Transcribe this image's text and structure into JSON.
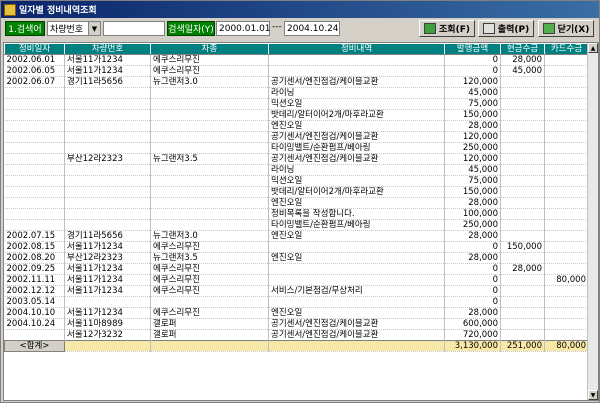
{
  "window": {
    "title": "일자별 정비내역조회"
  },
  "toolbar": {
    "search_label": "1.검색어",
    "search_field": "차량번호",
    "search_value": "",
    "date_label": "검색일자(Y)",
    "date_from": "2000.01.01",
    "date_sep": "---",
    "date_to": "2004.10.24",
    "query_button": "조회(F)",
    "print_button": "출력(P)",
    "close_button": "닫기(X)"
  },
  "grid": {
    "headers": [
      "정비일자",
      "차량번호",
      "차종",
      "정비내역",
      "발행금액",
      "현금수금",
      "카드수금"
    ],
    "rows": [
      [
        "2002.06.01",
        "서울11가1234",
        "에쿠스리무진",
        "",
        "0",
        "28,000",
        ""
      ],
      [
        "2002.06.05",
        "서울11가1234",
        "에쿠스리무진",
        "",
        "0",
        "45,000",
        ""
      ],
      [
        "2002.06.07",
        "경기11라5656",
        "뉴그랜저3.0",
        "공기센서/엔진점검/케이블교환",
        "120,000",
        "",
        ""
      ],
      [
        "",
        "",
        "",
        "라이닝",
        "45,000",
        "",
        ""
      ],
      [
        "",
        "",
        "",
        "믹션오일",
        "75,000",
        "",
        ""
      ],
      [
        "",
        "",
        "",
        "밧데리/알터이어2개/마후라교환",
        "150,000",
        "",
        ""
      ],
      [
        "",
        "",
        "",
        "엔진오일",
        "28,000",
        "",
        ""
      ],
      [
        "",
        "",
        "",
        "공기센서/엔진점검/케이블교환",
        "120,000",
        "",
        ""
      ],
      [
        "",
        "",
        "",
        "타이밍밸트/순환펌프/베아링",
        "250,000",
        "",
        ""
      ],
      [
        "",
        "부산12라2323",
        "뉴그랜저3.5",
        "공기센서/엔진점검/케이블교환",
        "120,000",
        "",
        ""
      ],
      [
        "",
        "",
        "",
        "라이닝",
        "45,000",
        "",
        ""
      ],
      [
        "",
        "",
        "",
        "믹션오일",
        "75,000",
        "",
        ""
      ],
      [
        "",
        "",
        "",
        "밧데리/알터이어2개/마후라교환",
        "150,000",
        "",
        ""
      ],
      [
        "",
        "",
        "",
        "엔진오일",
        "28,000",
        "",
        ""
      ],
      [
        "",
        "",
        "",
        "정비목록을 작성합니다.",
        "100,000",
        "",
        ""
      ],
      [
        "",
        "",
        "",
        "타이밍밸트/순환펌프/베아링",
        "250,000",
        "",
        ""
      ],
      [
        "2002.07.15",
        "경기11라5656",
        "뉴그랜저3.0",
        "엔진오일",
        "28,000",
        "",
        ""
      ],
      [
        "2002.08.15",
        "서울11가1234",
        "에쿠스리무진",
        "",
        "0",
        "150,000",
        ""
      ],
      [
        "2002.08.20",
        "부산12라2323",
        "뉴그랜저3.5",
        "엔진오일",
        "28,000",
        "",
        ""
      ],
      [
        "2002.09.25",
        "서울11가1234",
        "에쿠스리무진",
        "",
        "0",
        "28,000",
        ""
      ],
      [
        "2002.11.11",
        "서울11가1234",
        "에쿠스리무진",
        "",
        "0",
        "",
        "80,000"
      ],
      [
        "2002.12.12",
        "서울11가1234",
        "에쿠스리무진",
        "서비스/기본점검/무상처리",
        "0",
        "",
        ""
      ],
      [
        "2003.05.14",
        "",
        "",
        "",
        "0",
        "",
        ""
      ],
      [
        "2004.10.10",
        "서울11가1234",
        "에쿠스리무진",
        "엔진오일",
        "28,000",
        "",
        ""
      ],
      [
        "2004.10.24",
        "서울11마8989",
        "갤로퍼",
        "공기센서/엔진점검/케이블교환",
        "600,000",
        "",
        ""
      ],
      [
        "",
        "서울12가3232",
        "갤로퍼",
        "공기센서/엔진점검/케이블교환",
        "720,000",
        "",
        ""
      ]
    ],
    "total": {
      "label": "<합계>",
      "amount": "3,130,000",
      "cash": "251,000",
      "card": "80,000"
    }
  }
}
